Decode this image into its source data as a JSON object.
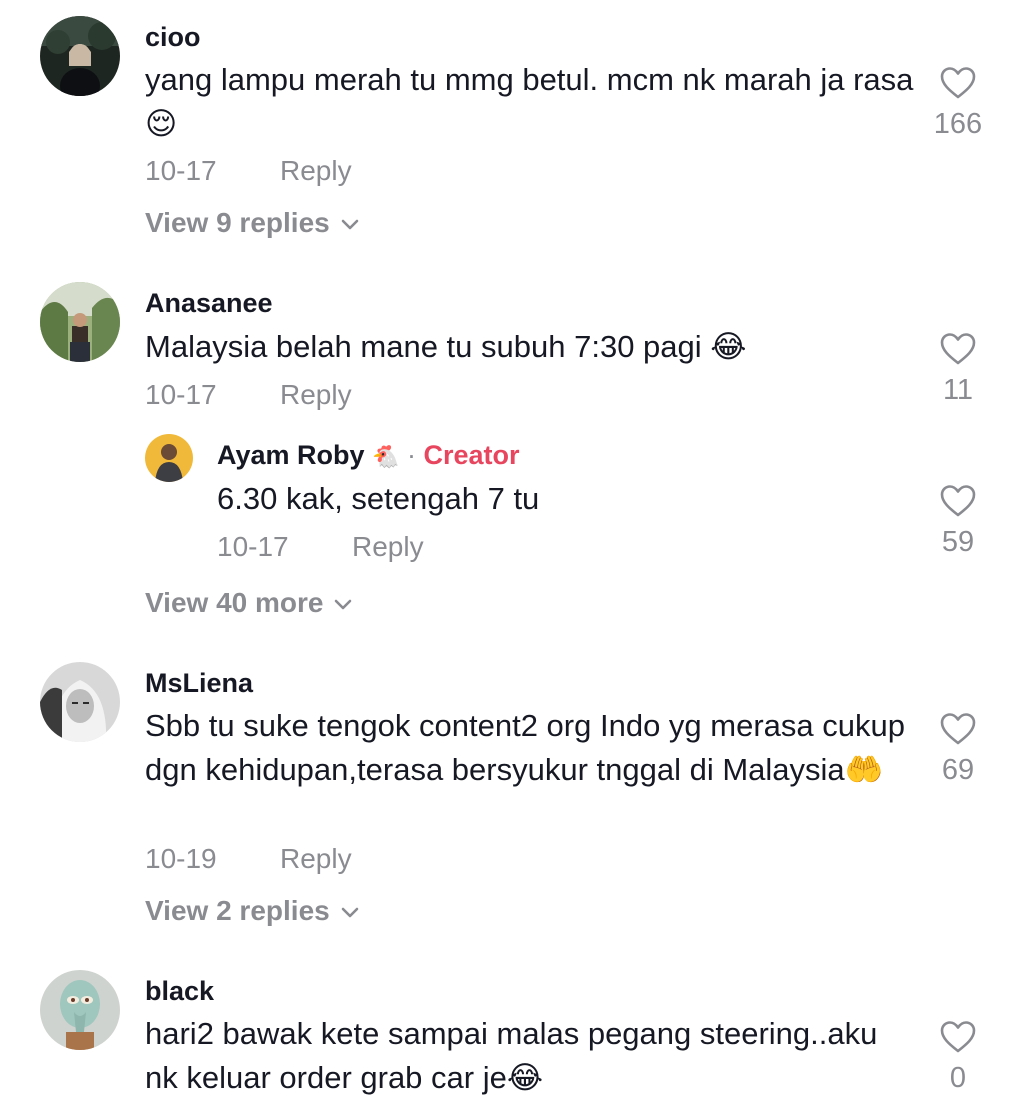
{
  "comments": [
    {
      "username": "cioo",
      "text": "yang lampu merah tu mmg betul. mcm nk marah ja rasa😌",
      "date": "10-17",
      "reply_label": "Reply",
      "likes": "166",
      "view_replies": "View 9 replies"
    },
    {
      "username": "Anasanee",
      "text": "Malaysia belah mane tu subuh 7:30 pagi 😂",
      "date": "10-17",
      "reply_label": "Reply",
      "likes": "11",
      "reply": {
        "username": "Ayam Roby",
        "username_emoji": "🐔",
        "separator": "·",
        "badge": "Creator",
        "text": "6.30 kak, setengah 7 tu",
        "date": "10-17",
        "reply_label": "Reply",
        "likes": "59"
      },
      "view_replies": "View 40 more"
    },
    {
      "username": "MsLiena",
      "text": "Sbb tu suke tengok content2 org Indo yg merasa cukup dgn kehidupan,terasa bersyukur tnggal di Malaysia🤲",
      "date": "10-19",
      "reply_label": "Reply",
      "likes": "69",
      "view_replies": "View 2 replies"
    },
    {
      "username": "black",
      "text": "hari2 bawak kete sampai malas pegang steering..aku nk keluar order grab car je😂",
      "likes": "0"
    }
  ],
  "icons": {
    "like": "heart-outline-icon",
    "expand": "chevron-down-icon"
  },
  "colors": {
    "text": "#161823",
    "muted": "#8a8b91",
    "creator_badge": "#e8455e"
  }
}
